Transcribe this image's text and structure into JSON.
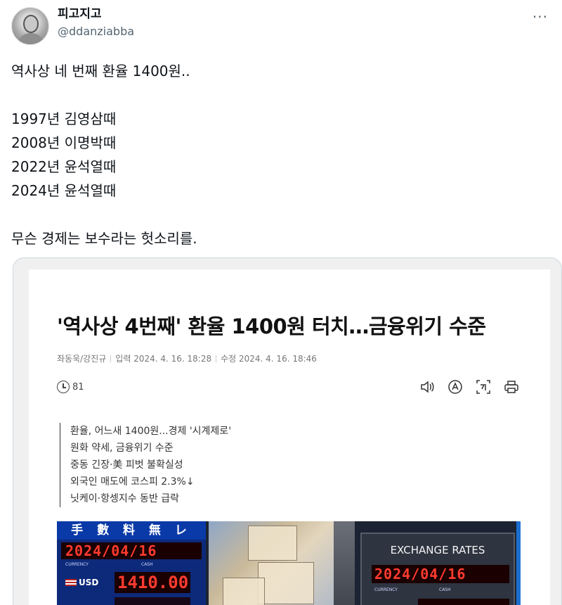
{
  "author": {
    "display_name": "피고지고",
    "handle": "@ddanziabba"
  },
  "more_label": "···",
  "tweet": {
    "lines": [
      "역사상 네 번째 환율 1400원..",
      "",
      "1997년 김영삼때",
      "2008년 이명박때",
      "2022년 윤석열때",
      "2024년 윤석열때",
      "",
      "무슨 경제는 보수라는 헛소리를."
    ]
  },
  "article": {
    "title": "'역사상 4번째' 환율 1400원 터치…금융위기 수준",
    "byline": {
      "reporters": "좌동욱/강진규",
      "published": "입력 2024. 4. 16. 18:28",
      "modified": "수정 2024. 4. 16. 18:46"
    },
    "view_count": "81",
    "tool_icons": [
      "speaker-icon",
      "text-size-icon",
      "translate-icon",
      "print-icon"
    ],
    "summary": [
      "환율, 어느새 1400원...경제 '시계제로'",
      "원화 약세, 금융위기 수준",
      "중동 긴장·美 피벗 불확실성",
      "외국인 매도에 코스피 2.3%↓",
      "닛케이·항셍지수 동반 급락"
    ],
    "photo": {
      "left_sign": {
        "header": "手 數 料 無 レ",
        "date": "2024/04/16",
        "currency_label": "CURRENCY",
        "cash_label": "CASH",
        "currency": "USD",
        "rate": "1410.00"
      },
      "right_sign": {
        "title": "EXCHANGE RATES",
        "date": "2024/04/16",
        "currency_label": "CURRENCY",
        "cash_label": "CASH"
      }
    }
  },
  "colors": {
    "text": "#0f1419",
    "secondary": "#536471",
    "card_border": "#cfd9de",
    "led_red": "#ff3b2f"
  }
}
